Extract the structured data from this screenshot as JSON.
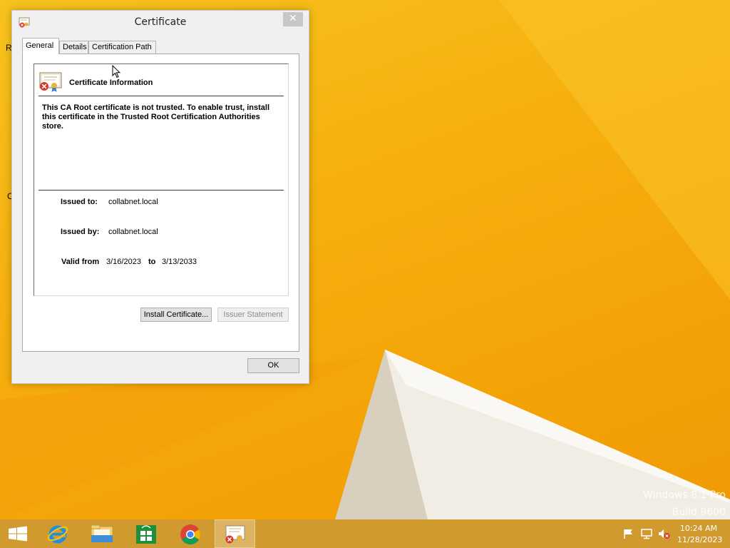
{
  "desktop": {
    "watermark_line1": "Windows 8.1 Pro",
    "watermark_line2": "Build 9600",
    "edge_fragments": [
      "R",
      "C"
    ]
  },
  "window": {
    "title": "Certificate",
    "close_glyph": "✕",
    "tabs": [
      {
        "label": "General",
        "active": true
      },
      {
        "label": "Details",
        "active": false
      },
      {
        "label": "Certification Path",
        "active": false
      }
    ],
    "info_title": "Certificate Information",
    "warning_text": "This CA Root certificate is not trusted. To enable trust, install this certificate in the Trusted Root Certification Authorities store.",
    "issued_to_label": "Issued to:",
    "issued_to_value": "collabnet.local",
    "issued_by_label": "Issued by:",
    "issued_by_value": "collabnet.local",
    "valid_from_label": "Valid from",
    "valid_from_value": "3/16/2023",
    "valid_to_label": "to",
    "valid_to_value": "3/13/2033",
    "install_button": "Install Certificate...",
    "issuer_button": "Issuer Statement",
    "ok_button": "OK"
  },
  "taskbar": {
    "items": [
      "start-icon",
      "internet-explorer-icon",
      "file-explorer-icon",
      "store-icon",
      "chrome-icon",
      "certificate-icon"
    ],
    "tray_icons": [
      "flag-icon",
      "network-icon",
      "volume-muted-icon"
    ],
    "time": "10:24 AM",
    "date": "11/28/2023"
  },
  "colors": {
    "wallpaper": "#f6b20f",
    "taskbar": "#d19a2e",
    "window_bg": "#f0f0f0"
  }
}
